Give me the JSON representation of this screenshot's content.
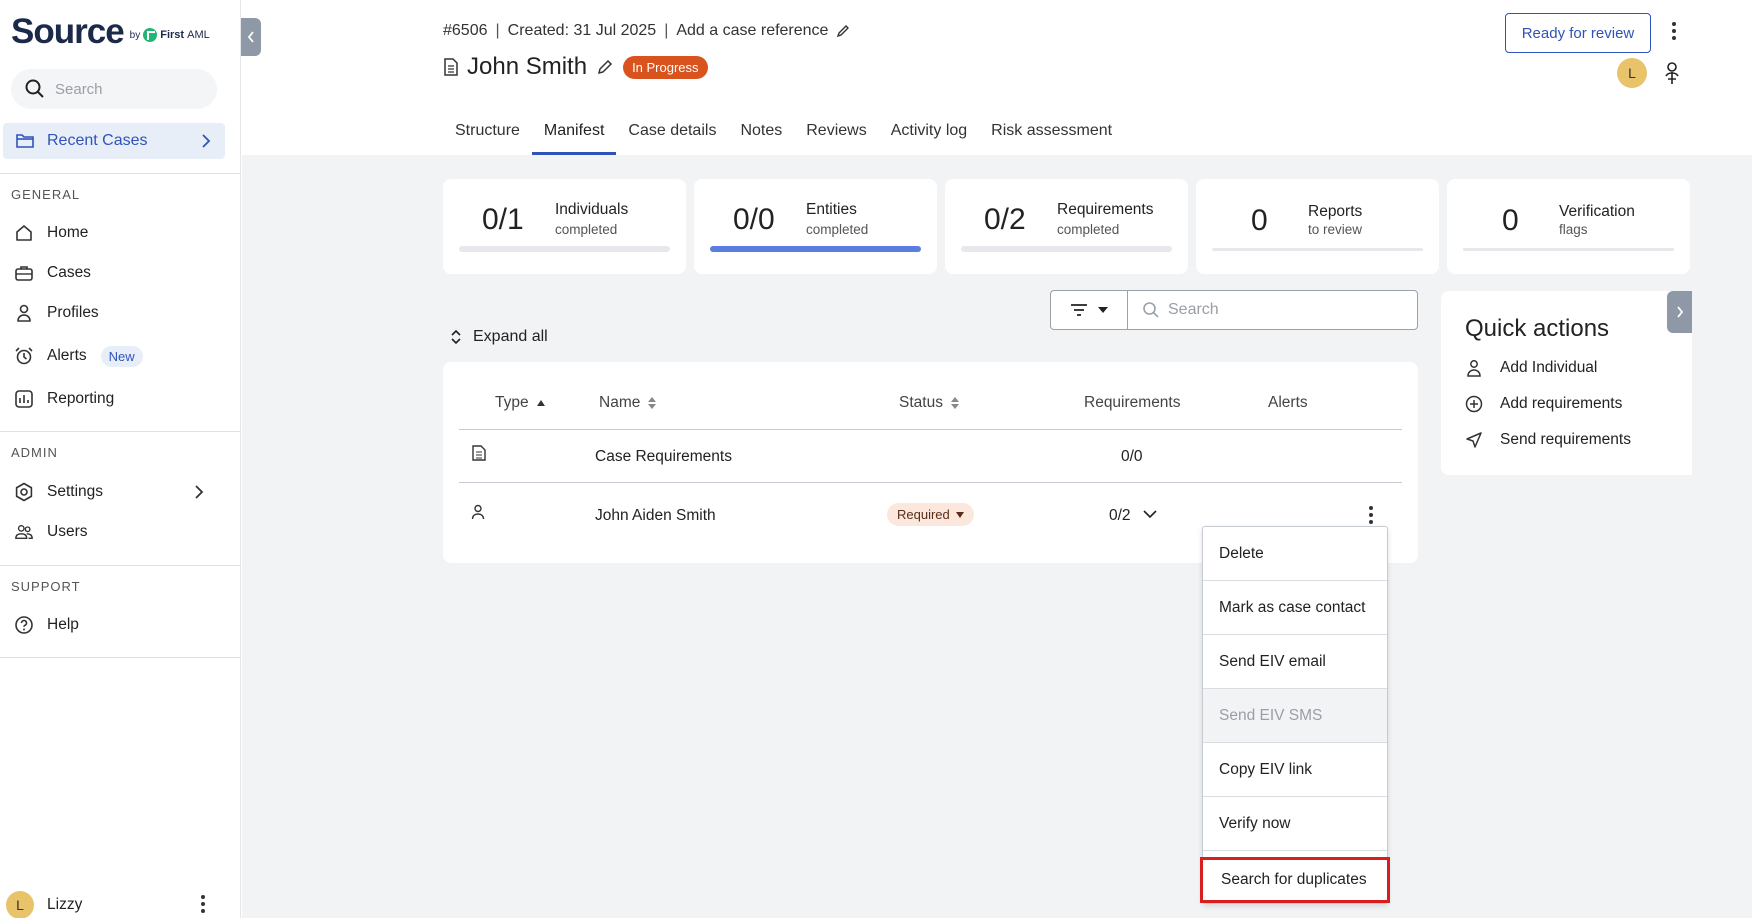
{
  "sidebar": {
    "logo": {
      "word": "Source",
      "by": "by",
      "brand": "First",
      "brand_suffix": "AML"
    },
    "search_placeholder": "Search",
    "recent_cases": "Recent Cases",
    "sections": {
      "general": "GENERAL",
      "admin": "ADMIN",
      "support": "SUPPORT"
    },
    "items": {
      "home": "Home",
      "cases": "Cases",
      "profiles": "Profiles",
      "alerts": "Alerts",
      "alerts_badge": "New",
      "reporting": "Reporting",
      "settings": "Settings",
      "users": "Users",
      "help": "Help"
    },
    "user": {
      "initial": "L",
      "name": "Lizzy"
    }
  },
  "header": {
    "case_number": "#6506",
    "created": "Created: 31 Jul 2025",
    "add_reference": "Add a case reference",
    "title": "John Smith",
    "status": "In Progress",
    "ready_button": "Ready for review",
    "assignee_initial": "L"
  },
  "tabs": [
    "Structure",
    "Manifest",
    "Case details",
    "Notes",
    "Reviews",
    "Activity log",
    "Risk assessment"
  ],
  "active_tab": "Manifest",
  "stats": [
    {
      "value": "0/1",
      "label": "Individuals",
      "sub": "completed",
      "progress": 0
    },
    {
      "value": "0/0",
      "label": "Entities",
      "sub": "completed",
      "progress": 1
    },
    {
      "value": "0/2",
      "label": "Requirements",
      "sub": "completed",
      "progress": 0
    },
    {
      "value": "0",
      "label": "Reports",
      "sub": "to review",
      "progress": 0
    },
    {
      "value": "0",
      "label": "Verification",
      "sub": "flags",
      "progress": 0
    }
  ],
  "toolbar": {
    "search_placeholder": "Search",
    "expand_all": "Expand all"
  },
  "table": {
    "columns": [
      "Type",
      "Name",
      "Status",
      "Requirements",
      "Alerts"
    ],
    "rows": [
      {
        "type_icon": "document-icon",
        "name": "Case Requirements",
        "status": "",
        "requirements": "0/0"
      },
      {
        "type_icon": "person-icon",
        "name": "John Aiden Smith",
        "status": "Required",
        "requirements": "0/2"
      }
    ]
  },
  "quick_actions": {
    "title": "Quick actions",
    "items": [
      "Add Individual",
      "Add requirements",
      "Send requirements"
    ]
  },
  "context_menu": {
    "items": [
      "Delete",
      "Mark as case contact",
      "Send EIV email",
      "Send EIV SMS",
      "Copy EIV link",
      "Verify now",
      "Search for duplicates"
    ],
    "disabled": [
      "Send EIV SMS"
    ],
    "highlighted": "Search for duplicates"
  },
  "colors": {
    "accent": "#2f53b9",
    "status_in_progress": "#d9531e",
    "highlight": "#d81f1f"
  }
}
